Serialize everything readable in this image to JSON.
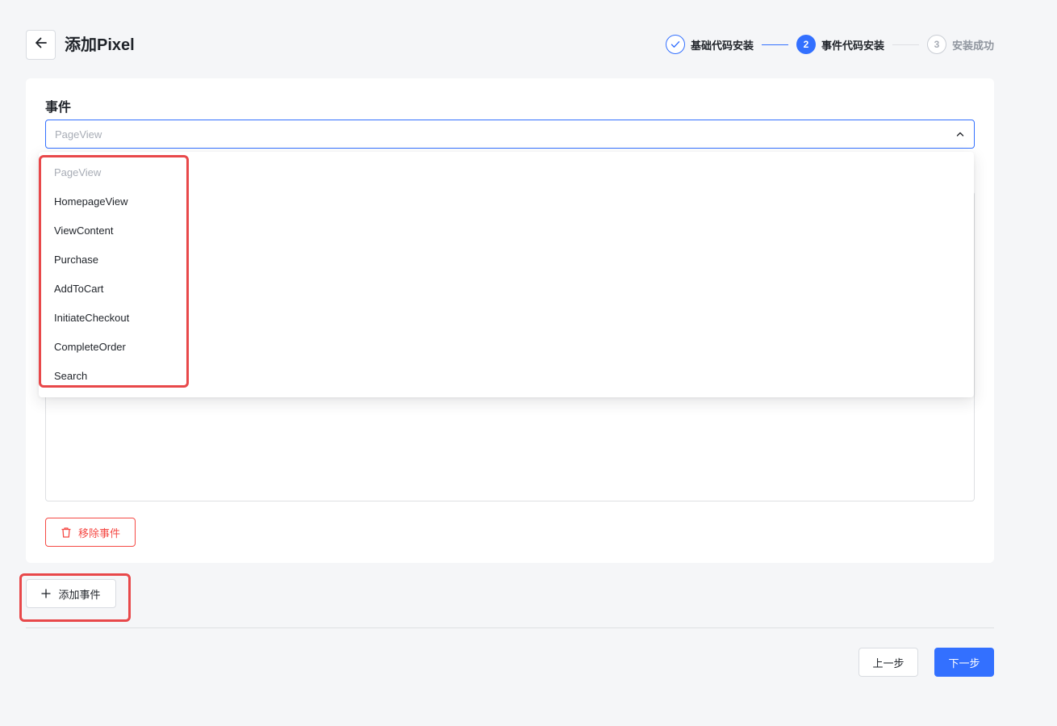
{
  "header": {
    "title": "添加Pixel"
  },
  "steps": [
    {
      "number": "",
      "label": "基础代码安装",
      "state": "done"
    },
    {
      "number": "2",
      "label": "事件代码安装",
      "state": "active"
    },
    {
      "number": "3",
      "label": "安装成功",
      "state": "todo"
    }
  ],
  "event_card": {
    "label": "事件",
    "select_value": "PageView",
    "remove_label": "移除事件"
  },
  "dropdown": {
    "options": [
      "PageView",
      "HomepageView",
      "ViewContent",
      "Purchase",
      "AddToCart",
      "InitiateCheckout",
      "CompleteOrder",
      "Search"
    ]
  },
  "actions": {
    "add_event_label": "添加事件",
    "prev_label": "上一步",
    "next_label": "下一步"
  },
  "colors": {
    "primary": "#3370ff",
    "danger": "#f54a45",
    "highlight": "#e8484a"
  }
}
